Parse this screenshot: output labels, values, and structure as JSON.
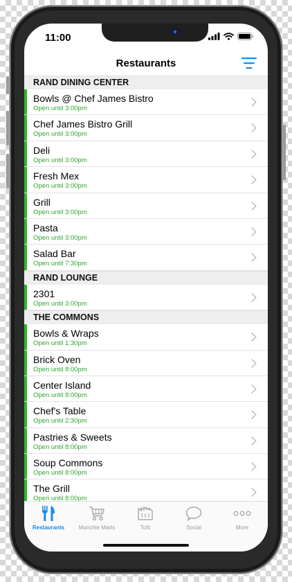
{
  "status": {
    "time": "11:00"
  },
  "nav": {
    "title": "Restaurants"
  },
  "sections": [
    {
      "title": "RAND DINING CENTER",
      "items": [
        {
          "name": "Bowls @ Chef James Bistro",
          "hours": "Open until 3:00pm"
        },
        {
          "name": "Chef James Bistro Grill",
          "hours": "Open until 3:00pm"
        },
        {
          "name": "Deli",
          "hours": "Open until 3:00pm"
        },
        {
          "name": "Fresh Mex",
          "hours": "Open until 3:00pm"
        },
        {
          "name": "Grill",
          "hours": "Open until 3:00pm"
        },
        {
          "name": "Pasta",
          "hours": "Open until 3:00pm"
        },
        {
          "name": "Salad Bar",
          "hours": "Open until 7:30pm"
        }
      ]
    },
    {
      "title": "RAND LOUNGE",
      "items": [
        {
          "name": "2301",
          "hours": "Open until 3:00pm"
        }
      ]
    },
    {
      "title": "THE COMMONS",
      "items": [
        {
          "name": "Bowls & Wraps",
          "hours": "Open until 1:30pm"
        },
        {
          "name": "Brick Oven",
          "hours": "Open until 8:00pm"
        },
        {
          "name": "Center Island",
          "hours": "Open until 8:00pm"
        },
        {
          "name": "Chef's Table",
          "hours": "Open until 2:30pm"
        },
        {
          "name": "Pastries & Sweets",
          "hours": "Open until 8:00pm"
        },
        {
          "name": "Soup Commons",
          "hours": "Open until 8:00pm"
        },
        {
          "name": "The Grill",
          "hours": "Open until 8:00pm"
        }
      ]
    }
  ],
  "tabs": [
    {
      "label": "Restaurants",
      "icon": "fork-knife-icon",
      "active": true
    },
    {
      "label": "Munchie Marts",
      "icon": "cart-icon",
      "active": false
    },
    {
      "label": "ToN",
      "icon": "building-icon",
      "active": false
    },
    {
      "label": "Social",
      "icon": "chat-bubble-icon",
      "active": false
    },
    {
      "label": "More",
      "icon": "more-dots-icon",
      "active": false
    }
  ],
  "colors": {
    "accent": "#1a8ae0",
    "open_green": "#2fa52f",
    "indicator_green": "#2db82d"
  }
}
